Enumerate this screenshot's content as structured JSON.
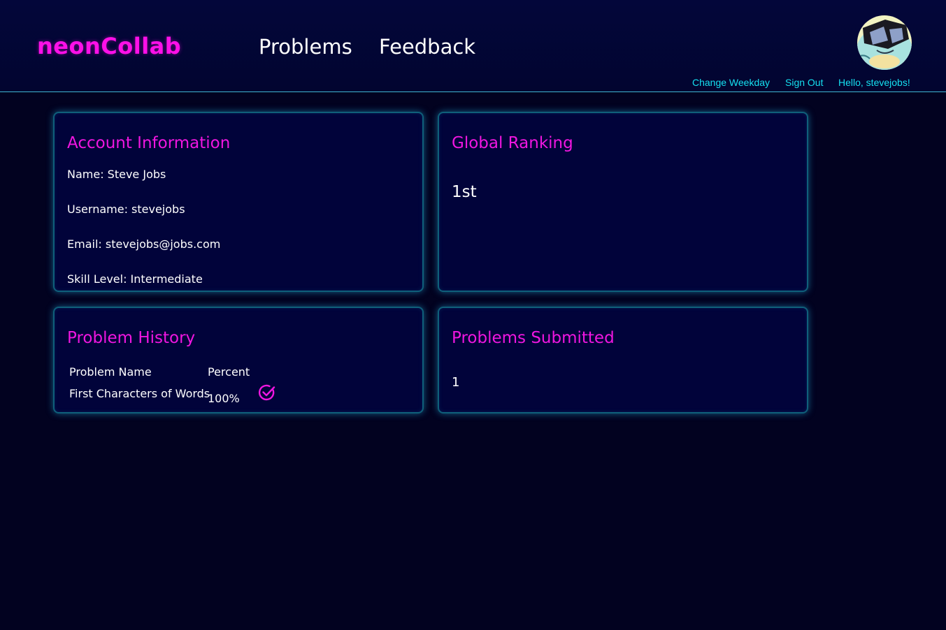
{
  "header": {
    "logo": "neonCollab",
    "nav": {
      "problems": "Problems",
      "feedback": "Feedback"
    },
    "user_links": {
      "change_weekday": "Change Weekday",
      "sign_out": "Sign Out",
      "greeting": "Hello, stevejobs!"
    }
  },
  "account": {
    "title": "Account Information",
    "name": "Name: Steve Jobs",
    "username": "Username: stevejobs",
    "email": "Email: stevejobs@jobs.com",
    "skill": "Skill Level: Intermediate"
  },
  "ranking": {
    "title": "Global Ranking",
    "value": "1st"
  },
  "history": {
    "title": "Problem History",
    "columns": [
      "Problem Name",
      "Percent"
    ],
    "rows": [
      {
        "name": "First Characters of Words",
        "percent": "100%",
        "icon": "check-circle-icon"
      }
    ]
  },
  "submitted": {
    "title": "Problems Submitted",
    "value": "1"
  },
  "colors": {
    "background": "#020220",
    "accent_pink": "#f016e0",
    "accent_cyan": "#15e0f0",
    "card_border": "#0f5f7a"
  }
}
